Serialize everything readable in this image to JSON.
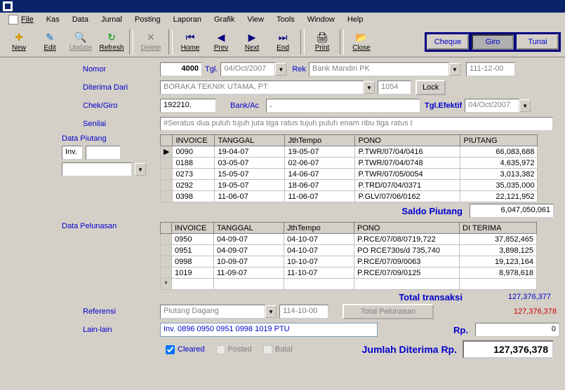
{
  "menu": [
    "File",
    "Kas",
    "Data",
    "Jurnal",
    "Posting",
    "Laporan",
    "Grafik",
    "View",
    "Tools",
    "Window",
    "Help"
  ],
  "toolbar": {
    "new": "New",
    "edit": "Edit",
    "update": "Update",
    "refresh": "Refresh",
    "delete": "Delete",
    "home": "Home",
    "prev": "Prev",
    "next": "Next",
    "end": "End",
    "print": "Print",
    "close": "Close"
  },
  "pay": {
    "cheque": "Cheque",
    "giro": "Giro",
    "tunai": "Tunai",
    "active": "giro"
  },
  "labels": {
    "nomor": "Nomor",
    "tgl": "Tgl.",
    "rek": "Rek",
    "diterima": "Diterima Dari",
    "chekgiro": "Chek/Giro",
    "bankac": "Bank/Ac",
    "tglefektif": "Tgl.Efektif",
    "senilai": "Senilai",
    "datapiutang": "Data Piutang",
    "inv": "Inv.",
    "datapelunasan": "Data Pelunasan",
    "saldo": "Saldo Piutang",
    "totaltrans": "Total transaksi",
    "referensi": "Referensi",
    "totalpelunasan": "Total Pelunasan",
    "lainlain": "Lain-lain",
    "rp": "Rp.",
    "cleared": "Cleared",
    "posted": "Posted",
    "batal": "Batal",
    "jumlah": "Jumlah Diterima  Rp."
  },
  "fields": {
    "nomor": "4000",
    "tgl": "04/Oct/2007",
    "rek": "Bank Mandiri PK",
    "rekcode": "111-12-00",
    "diterima": "BORAKA TEKNIK UTAMA, PT",
    "diterimacode": "1054",
    "lock": "Lock",
    "chekgiro": "192210.",
    "bankac": ".",
    "tglefektif": "04/Oct/2007",
    "senilai": "#Seratus dua puluh  tujuh  juta  tiga ratus tujuh puluh  enam  ribu  tiga ratus t",
    "referensi": "Piutang Dagang",
    "refcode": "114-10-00",
    "lainlain": "Inv. 0896 0950 0951 0998 1019 PTU",
    "rp": "0"
  },
  "piutang_headers": [
    "INVOICE",
    "TANGGAL",
    "JthTempo",
    "PONO",
    "PIUTANG"
  ],
  "piutang": [
    {
      "inv": "0090",
      "tgl": "19-04-07",
      "jth": "19-05-07",
      "pono": "P.TWR/07/04/0416",
      "val": "66,083,688"
    },
    {
      "inv": "0188",
      "tgl": "03-05-07",
      "jth": "02-06-07",
      "pono": "P.TWR/07/04/0748",
      "val": "4,635,972"
    },
    {
      "inv": "0273",
      "tgl": "15-05-07",
      "jth": "14-06-07",
      "pono": "P.TWR/07/05/0054",
      "val": "3,013,382"
    },
    {
      "inv": "0292",
      "tgl": "19-05-07",
      "jth": "18-06-07",
      "pono": "P.TRD/07/04/0371",
      "val": "35,035,000"
    },
    {
      "inv": "0398",
      "tgl": "11-06-07",
      "jth": "11-06-07",
      "pono": "P.GLV/07/06/0162",
      "val": "22,121,952"
    }
  ],
  "pelunasan_headers": [
    "INVOICE",
    "TANGGAL",
    "JthTempo",
    "PONO",
    "DI TERIMA"
  ],
  "pelunasan": [
    {
      "inv": "0950",
      "tgl": "04-09-07",
      "jth": "04-10-07",
      "pono": "P.RCE/07/08/0719,722",
      "val": "37,852,465"
    },
    {
      "inv": "0951",
      "tgl": "04-09-07",
      "jth": "04-10-07",
      "pono": "PO RCE730s/d 735,740",
      "val": "3,898,125"
    },
    {
      "inv": "0998",
      "tgl": "10-09-07",
      "jth": "10-10-07",
      "pono": "P.RCE/07/09/0063",
      "val": "19,123,164"
    },
    {
      "inv": "1019",
      "tgl": "11-09-07",
      "jth": "11-10-07",
      "pono": "P.RCE/07/09/0125",
      "val": "8,978,618"
    }
  ],
  "totals": {
    "saldo": "6,047,050,061",
    "totaltrans": "127,376,377",
    "totalpelunasan": "127,376,378",
    "jumlah": "127,376,378"
  }
}
